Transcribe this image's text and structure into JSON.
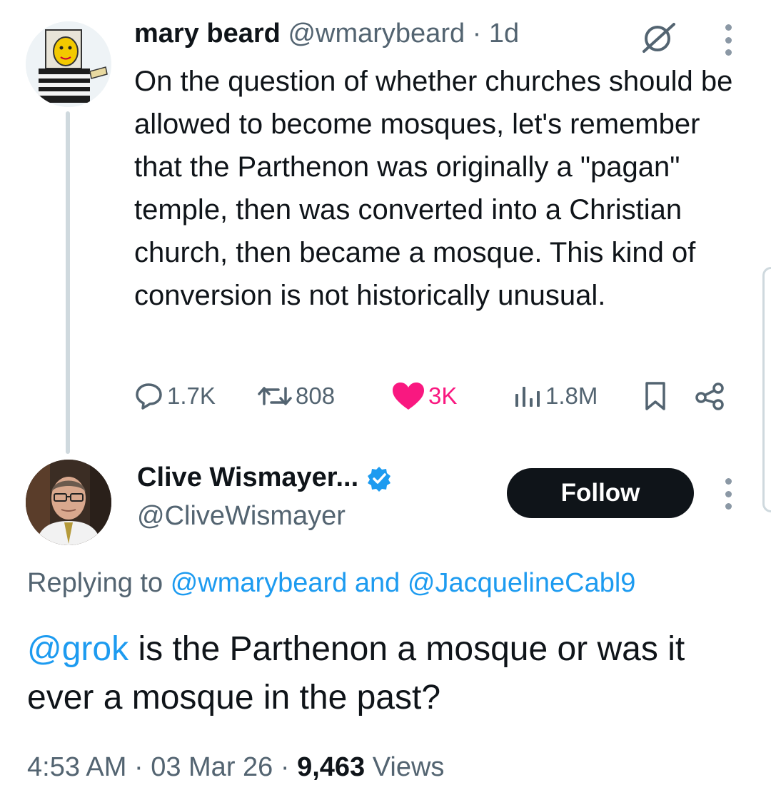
{
  "tweet1": {
    "author_name": "mary beard",
    "author_handle": "@wmarybeard",
    "separator": " · ",
    "time_ago": "1d",
    "text": "On the question of whether churches should be allowed to become mosques, let's remember that the Parthenon was originally a \"pagan\" temple, then was converted into a Christian church, then became a mosque. This kind of conversion is not historically unusual.",
    "stats": {
      "replies": "1.7K",
      "reposts": "808",
      "likes": "3K",
      "views": "1.8M"
    },
    "like_color": "#f91880"
  },
  "tweet2": {
    "author_name": "Clive Wismayer...",
    "author_handle": "@CliveWismayer",
    "follow_label": "Follow",
    "replying_label": "Replying to",
    "reply_to_1": "@wmarybeard",
    "reply_join": "and",
    "reply_to_2": "@JacquelineCabl9",
    "mention": "@grok",
    "text": " is the Parthenon a mosque or was it ever a mosque in the past?",
    "time": "4:53 AM",
    "date": "03 Mar 26",
    "views_count": "9,463",
    "views_label": "Views",
    "meta_sep": " · "
  },
  "colors": {
    "link": "#1d9bf0",
    "muted": "#536471",
    "text": "#0f1419",
    "verified": "#1d9bf0"
  },
  "icons": {
    "grok": "grok-slash-icon",
    "more": "more-vertical-icon",
    "reply": "reply-bubble-icon",
    "repost": "repost-icon",
    "like": "heart-icon",
    "views": "views-bars-icon",
    "bookmark": "bookmark-icon",
    "share": "share-icon",
    "verified": "verified-badge-icon"
  }
}
